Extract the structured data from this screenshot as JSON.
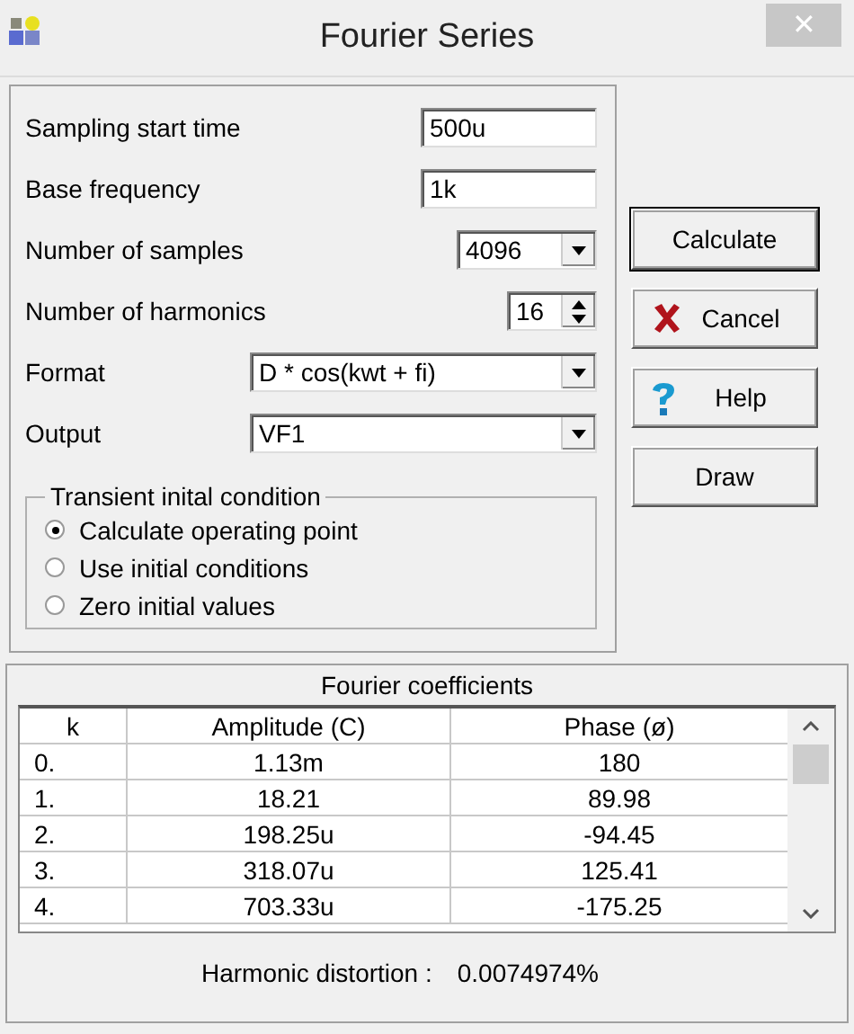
{
  "window": {
    "title": "Fourier Series",
    "close": "✕"
  },
  "fields": [
    {
      "kind": "text",
      "label": "Sampling start time",
      "value": "500u"
    },
    {
      "kind": "text",
      "label": "Base frequency",
      "value": "1k"
    },
    {
      "kind": "combo",
      "label": "Number of samples",
      "value": "4096"
    },
    {
      "kind": "spin",
      "label": "Number of harmonics",
      "value": "16"
    },
    {
      "kind": "widecombo",
      "label": "Format",
      "value": "D * cos(kwt + fi)"
    },
    {
      "kind": "widecombo",
      "label": "Output",
      "value": "VF1"
    }
  ],
  "transient": {
    "title": "Transient inital condition",
    "options": [
      {
        "label": "Calculate operating point",
        "selected": true
      },
      {
        "label": "Use initial conditions",
        "selected": false
      },
      {
        "label": "Zero initial values",
        "selected": false
      }
    ]
  },
  "buttons": [
    {
      "kind": "plain",
      "label": "Calculate",
      "default": true
    },
    {
      "kind": "cancel",
      "label": "Cancel",
      "default": false
    },
    {
      "kind": "help",
      "label": "Help",
      "default": false
    },
    {
      "kind": "plain",
      "label": "Draw",
      "default": false
    }
  ],
  "coefficients": {
    "title": "Fourier coefficients",
    "columns": [
      "k",
      "Amplitude (C)",
      "Phase (ø)"
    ],
    "rows": [
      [
        "0.",
        "1.13m",
        "180"
      ],
      [
        "1.",
        "18.21",
        "89.98"
      ],
      [
        "2.",
        "198.25u",
        "-94.45"
      ],
      [
        "3.",
        "318.07u",
        "125.41"
      ],
      [
        "4.",
        "703.33u",
        "-175.25"
      ]
    ],
    "distortion_label": "Harmonic distortion :",
    "distortion_value": "0.0074974%"
  }
}
